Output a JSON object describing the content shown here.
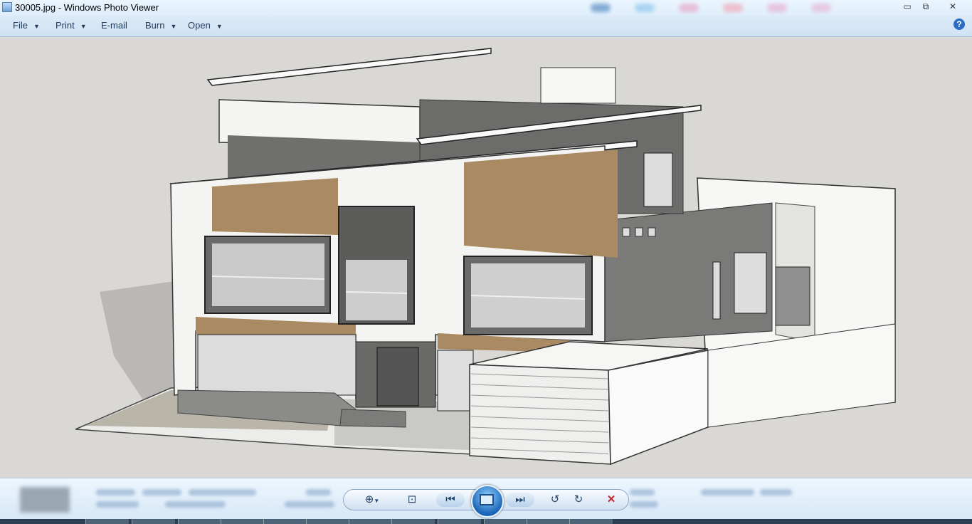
{
  "window": {
    "title": "30005.jpg - Windows Photo Viewer",
    "controls": {
      "minimize": "▭",
      "restore": "⧉",
      "close": "✕"
    }
  },
  "menu": {
    "file": "File",
    "print": "Print",
    "email": "E-mail",
    "burn": "Burn",
    "open": "Open",
    "help": "?"
  },
  "image": {
    "subject": "architectural-3d-render-house"
  },
  "playback": {
    "zoom_icon": "zoom-icon",
    "fit_icon": "actual-size-icon",
    "previous_icon": "previous-icon",
    "slideshow_icon": "slideshow-icon",
    "next_icon": "next-icon",
    "rotate_ccw_icon": "rotate-counterclockwise-icon",
    "rotate_cw_icon": "rotate-clockwise-icon",
    "delete_icon": "delete-icon"
  },
  "colors": {
    "delete": "#c0262c",
    "accent": "#1a64b8"
  }
}
